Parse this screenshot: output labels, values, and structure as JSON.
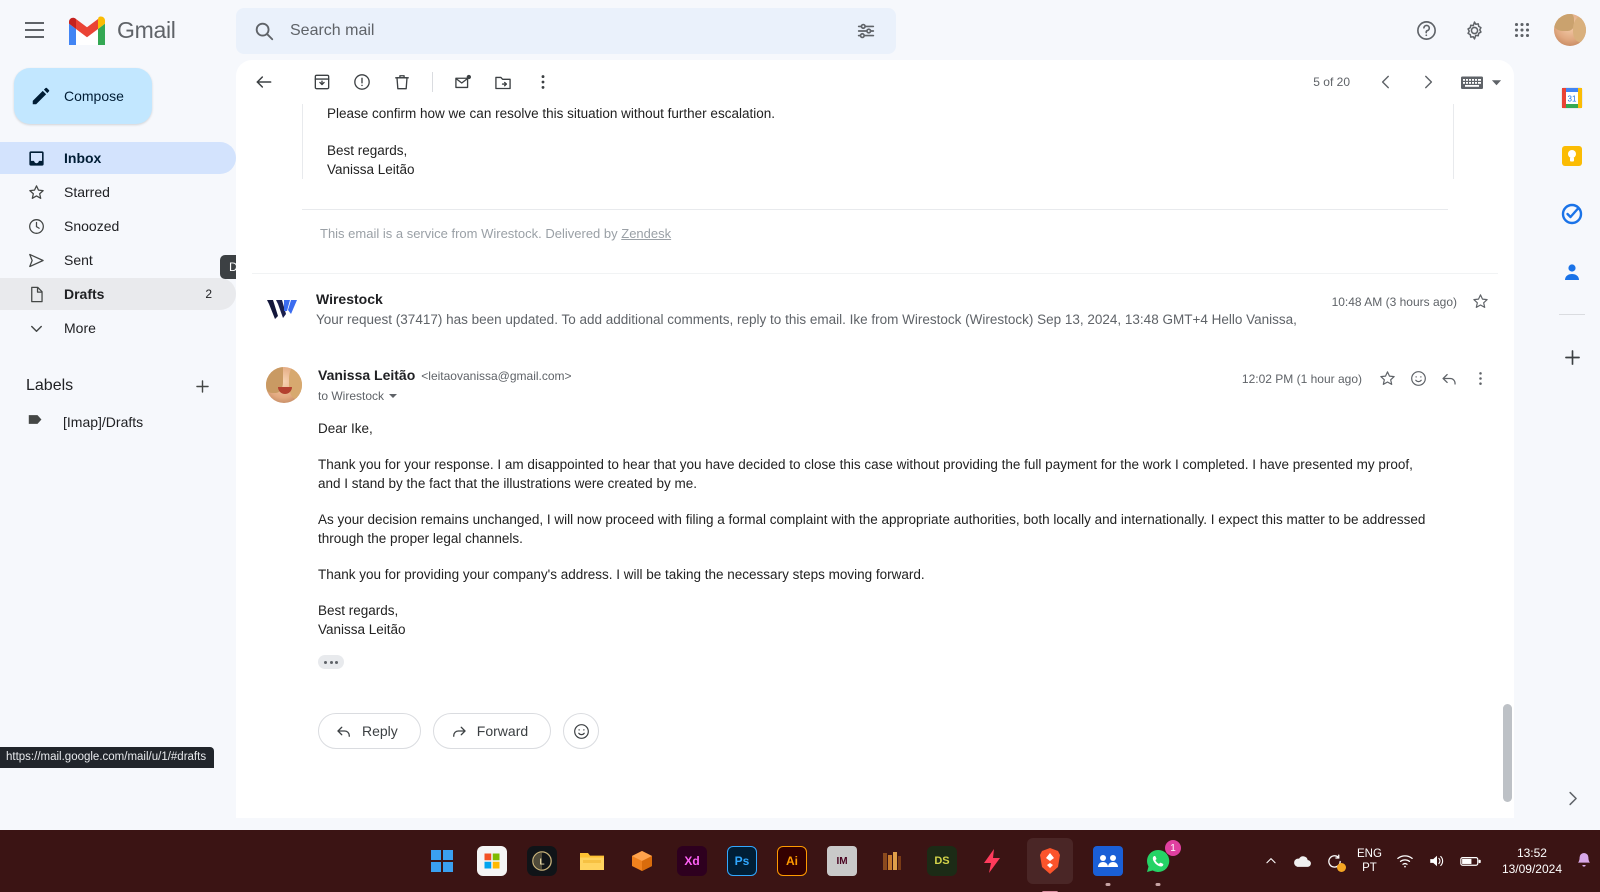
{
  "app": {
    "name": "Gmail",
    "menu_icon": "hamburger-icon"
  },
  "search": {
    "placeholder": "Search mail",
    "value": "",
    "icon": "search-icon",
    "options_icon": "search-options-icon"
  },
  "top_right": {
    "help_icon": "help-icon",
    "settings_icon": "gear-icon",
    "apps_icon": "apps-grid-icon",
    "avatar": "account-avatar"
  },
  "sidebar": {
    "compose_label": "Compose",
    "items": [
      {
        "label": "Inbox",
        "icon": "inbox-icon",
        "count": "",
        "state": "active"
      },
      {
        "label": "Starred",
        "icon": "star-icon",
        "count": "",
        "state": "normal"
      },
      {
        "label": "Snoozed",
        "icon": "clock-icon",
        "count": "",
        "state": "normal"
      },
      {
        "label": "Sent",
        "icon": "send-icon",
        "count": "",
        "state": "normal"
      },
      {
        "label": "Drafts",
        "icon": "draft-icon",
        "count": "2",
        "state": "hovered"
      },
      {
        "label": "More",
        "icon": "chevron-down-icon",
        "count": "",
        "state": "normal"
      }
    ],
    "tooltip": "Drafts",
    "labels_title": "Labels",
    "labels_add_icon": "plus-icon",
    "labels": [
      {
        "label": "[Imap]/Drafts",
        "icon": "label-icon"
      }
    ]
  },
  "toolbar": {
    "back_icon": "back-arrow-icon",
    "archive_icon": "archive-icon",
    "spam_icon": "report-spam-icon",
    "delete_icon": "trash-icon",
    "unread_icon": "mark-unread-icon",
    "move_icon": "move-to-folder-icon",
    "more_icon": "more-vertical-icon",
    "pager_text": "5 of 20",
    "prev_icon": "chevron-left-icon",
    "next_icon": "chevron-right-icon",
    "input_tools_icon": "keyboard-icon",
    "input_tools_caret": "caret-down-icon"
  },
  "previous_message": {
    "line1": "Please confirm how we can resolve this situation without further escalation.",
    "signoff": "Best regards,",
    "signature": "Vanissa Leitão",
    "footer_prefix": "This email is a service from Wirestock. Delivered by ",
    "footer_link": "Zendesk"
  },
  "collapsed_message": {
    "sender": "Wirestock",
    "snippet": "Your request (37417) has been updated. To add additional comments, reply to this email. Ike from Wirestock (Wirestock) Sep 13, 2024, 13:48 GMT+4 Hello Vanissa,",
    "time": "10:48 AM (3 hours ago)",
    "star_icon": "star-outline-icon",
    "logo": "wirestock-logo"
  },
  "expanded_message": {
    "sender_name": "Vanissa Leitão",
    "sender_email": "<leitaovanissa@gmail.com>",
    "to_line": "to Wirestock",
    "time": "12:02 PM (1 hour ago)",
    "star_icon": "star-outline-icon",
    "react_icon": "add-reaction-icon",
    "reply_icon": "reply-icon",
    "more_icon": "more-vertical-icon",
    "body": {
      "greeting": "Dear Ike,",
      "p1": "Thank you for your response. I am disappointed to hear that you have decided to close this case without providing the full payment for the work I completed. I have presented my proof, and I stand by the fact that the illustrations were created by me.",
      "p2": "As your decision remains unchanged, I will now proceed with filing a formal complaint with the appropriate authorities, both locally and internationally. I expect this matter to be addressed through the proper legal channels.",
      "p3": "Thank you for providing your company's address. I will be taking the necessary steps moving forward.",
      "signoff": "Best regards,",
      "signature": "Vanissa Leitão"
    },
    "trim_icon": "show-trimmed-content-icon"
  },
  "actions": {
    "reply_label": "Reply",
    "reply_icon": "reply-icon",
    "forward_label": "Forward",
    "forward_icon": "forward-icon",
    "react_icon": "add-reaction-icon"
  },
  "side_panel": {
    "items": [
      {
        "name": "google-calendar-icon",
        "label": "31"
      },
      {
        "name": "google-keep-icon",
        "label": ""
      },
      {
        "name": "google-tasks-icon",
        "label": ""
      },
      {
        "name": "google-contacts-icon",
        "label": ""
      }
    ],
    "add_icon": "plus-icon",
    "expand_icon": "chevron-right-icon"
  },
  "status_bar": {
    "url": "https://mail.google.com/mail/u/1/#drafts"
  },
  "taskbar": {
    "apps": [
      {
        "name": "windows-start-icon",
        "label": "",
        "color": "#3aa0f0",
        "bg": "transparent"
      },
      {
        "name": "microsoft-store-icon",
        "label": "",
        "color": "#ffffff",
        "bg": "#f2f2f2"
      },
      {
        "name": "lightroom-icon",
        "label": "",
        "color": "#c8b27a",
        "bg": "#1a1a1a"
      },
      {
        "name": "file-explorer-icon",
        "label": "",
        "color": "#ffb400",
        "bg": "transparent"
      },
      {
        "name": "package-icon",
        "label": "",
        "color": "#f0821e",
        "bg": "transparent"
      },
      {
        "name": "adobe-xd-icon",
        "label": "Xd",
        "color": "#ff61f6",
        "bg": "#2e001f"
      },
      {
        "name": "adobe-photoshop-icon",
        "label": "Ps",
        "color": "#31a8ff",
        "bg": "#001e36"
      },
      {
        "name": "adobe-illustrator-icon",
        "label": "Ai",
        "color": "#ff9a00",
        "bg": "#330000"
      },
      {
        "name": "adobe-indesign-icon",
        "label": "IM",
        "color": "#49021f",
        "bg": "#c8c8c8"
      },
      {
        "name": "books-icon",
        "label": "",
        "color": "#c77b2e",
        "bg": "transparent"
      },
      {
        "name": "designs-icon",
        "label": "DS",
        "color": "#d4d44a",
        "bg": "#1c2b16"
      },
      {
        "name": "lightning-icon",
        "label": "",
        "color": "#ff3b5c",
        "bg": "transparent"
      },
      {
        "name": "brave-browser-icon",
        "label": "",
        "color": "#fb542b",
        "bg": "transparent"
      },
      {
        "name": "team-app-icon",
        "label": "",
        "color": "#ffffff",
        "bg": "#1a5fd6"
      },
      {
        "name": "whatsapp-icon",
        "label": "",
        "color": "#25d366",
        "bg": "transparent",
        "badge": "1"
      }
    ],
    "tray": {
      "overflow_icon": "chevron-up-icon",
      "onedrive_icon": "onedrive-icon",
      "update_icon": "windows-update-icon",
      "language_top": "ENG",
      "language_bottom": "PT",
      "wifi_icon": "wifi-icon",
      "volume_icon": "volume-icon",
      "battery_icon": "battery-icon",
      "time": "13:52",
      "date": "13/09/2024",
      "notification_icon": "bell-icon"
    }
  },
  "colors": {
    "gmail_red": "#ea4335",
    "gmail_blue": "#4285f4",
    "gmail_green": "#34a853",
    "gmail_yellow": "#fbbc04",
    "active_nav": "#d3e3fd",
    "compose_bg": "#c2e7ff",
    "taskbar_bg": "#3b1414"
  }
}
